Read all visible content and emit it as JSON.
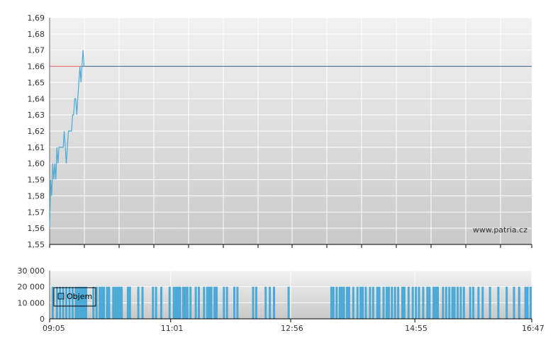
{
  "watermark": "www.patria.cz",
  "colors": {
    "price_line": "#4aa9d6",
    "reference_line_before": "#ea6f6f",
    "reference_line_after": "#4a6d98",
    "volume_bar": "#4aa9d6",
    "panel_bg_top": "#f2f2f2",
    "panel_bg_bottom": "#c9c9c9"
  },
  "chart_data": [
    {
      "type": "line",
      "panel": "price",
      "ylim": [
        1.55,
        1.69
      ],
      "yticks": [
        "1,55",
        "1,56",
        "1,57",
        "1,58",
        "1,59",
        "1,60",
        "1,61",
        "1,62",
        "1,63",
        "1,64",
        "1,65",
        "1,66",
        "1,67",
        "1,68",
        "1,69"
      ],
      "ytick_values": [
        1.55,
        1.56,
        1.57,
        1.58,
        1.59,
        1.6,
        1.61,
        1.62,
        1.63,
        1.64,
        1.65,
        1.66,
        1.67,
        1.68,
        1.69
      ],
      "xlim": [
        "09:05",
        "16:47"
      ],
      "reference_value": 1.66,
      "series": [
        {
          "x": [
            "09:05",
            "09:06",
            "09:07",
            "09:08",
            "09:09",
            "09:10",
            "09:11",
            "09:12",
            "09:13",
            "09:14",
            "09:15",
            "09:16",
            "09:17",
            "09:18",
            "09:19",
            "09:20",
            "09:21",
            "09:22",
            "09:23",
            "09:24",
            "09:25",
            "09:26",
            "09:27",
            "09:28",
            "09:29",
            "09:30",
            "09:31",
            "09:32",
            "09:33",
            "09:34",
            "09:35",
            "09:36",
            "09:37",
            "09:38"
          ],
          "values": [
            1.56,
            1.59,
            1.58,
            1.6,
            1.59,
            1.6,
            1.59,
            1.61,
            1.6,
            1.61,
            1.61,
            1.61,
            1.61,
            1.61,
            1.62,
            1.61,
            1.6,
            1.61,
            1.62,
            1.62,
            1.62,
            1.62,
            1.63,
            1.63,
            1.64,
            1.64,
            1.63,
            1.64,
            1.65,
            1.66,
            1.65,
            1.66,
            1.67,
            1.66
          ]
        }
      ]
    },
    {
      "type": "bar",
      "panel": "volume",
      "ylim": [
        0,
        30000
      ],
      "yticks": [
        "0",
        "10 000",
        "20 000",
        "30 000"
      ],
      "ytick_values": [
        0,
        10000,
        20000,
        30000
      ],
      "xticks": [
        "09:05",
        "11:01",
        "12:56",
        "14:55",
        "16:47"
      ],
      "legend": "Objem",
      "series": [
        {
          "name": "Objem",
          "x": [
            "09:08",
            "09:12",
            "09:15",
            "09:18",
            "09:21",
            "09:24",
            "09:27",
            "09:30",
            "09:32",
            "09:34",
            "09:36",
            "09:38",
            "09:40",
            "09:47",
            "09:50",
            "09:53",
            "09:55",
            "09:57",
            "10:00",
            "10:02",
            "10:06",
            "10:08",
            "10:10",
            "10:12",
            "10:14",
            "10:20",
            "10:22",
            "10:30",
            "10:34",
            "10:44",
            "10:47",
            "10:52",
            "11:00",
            "11:04",
            "11:06",
            "11:08",
            "11:10",
            "11:13",
            "11:15",
            "11:17",
            "11:20",
            "11:25",
            "11:28",
            "11:33",
            "11:36",
            "11:38",
            "11:40",
            "11:43",
            "11:45",
            "11:52",
            "11:55",
            "12:02",
            "12:05",
            "12:20",
            "12:23",
            "12:32",
            "12:36",
            "12:40",
            "12:54",
            "13:35",
            "13:37",
            "13:40",
            "13:43",
            "13:45",
            "13:47",
            "13:50",
            "13:52",
            "13:56",
            "14:00",
            "14:03",
            "14:05",
            "14:08",
            "14:12",
            "14:15",
            "14:19",
            "14:21",
            "14:25",
            "14:28",
            "14:30",
            "14:33",
            "14:36",
            "14:39",
            "14:43",
            "14:45",
            "14:49",
            "14:53",
            "14:56",
            "14:59",
            "15:03",
            "15:07",
            "15:09",
            "15:13",
            "15:15",
            "15:17",
            "15:22",
            "15:25",
            "15:28",
            "15:31",
            "15:33",
            "15:36",
            "15:39",
            "15:42",
            "15:48",
            "15:51",
            "15:56",
            "16:00",
            "16:07",
            "16:15",
            "16:23",
            "16:30",
            "16:35",
            "16:41",
            "16:43",
            "16:46"
          ],
          "values": [
            20000,
            20000,
            20000,
            20000,
            20000,
            20000,
            20000,
            20000,
            20000,
            20000,
            20000,
            20000,
            20000,
            20000,
            20000,
            20000,
            20000,
            20000,
            20000,
            20000,
            20000,
            20000,
            20000,
            20000,
            20000,
            20000,
            20000,
            20000,
            20000,
            20000,
            20000,
            20000,
            20000,
            20000,
            20000,
            20000,
            20000,
            20000,
            20000,
            20000,
            20000,
            20000,
            20000,
            20000,
            20000,
            20000,
            20000,
            20000,
            20000,
            20000,
            20000,
            20000,
            20000,
            20000,
            20000,
            20000,
            20000,
            20000,
            20000,
            20000,
            20000,
            20000,
            20000,
            20000,
            20000,
            20000,
            20000,
            20000,
            20000,
            20000,
            20000,
            20000,
            20000,
            20000,
            20000,
            20000,
            20000,
            20000,
            20000,
            20000,
            20000,
            20000,
            20000,
            20000,
            20000,
            20000,
            20000,
            20000,
            20000,
            20000,
            20000,
            20000,
            20000,
            20000,
            20000,
            20000,
            20000,
            20000,
            20000,
            20000,
            20000,
            20000,
            20000,
            20000,
            20000,
            20000,
            20000,
            20000,
            20000,
            20000,
            20000,
            20000,
            20000,
            20000
          ]
        }
      ]
    }
  ]
}
